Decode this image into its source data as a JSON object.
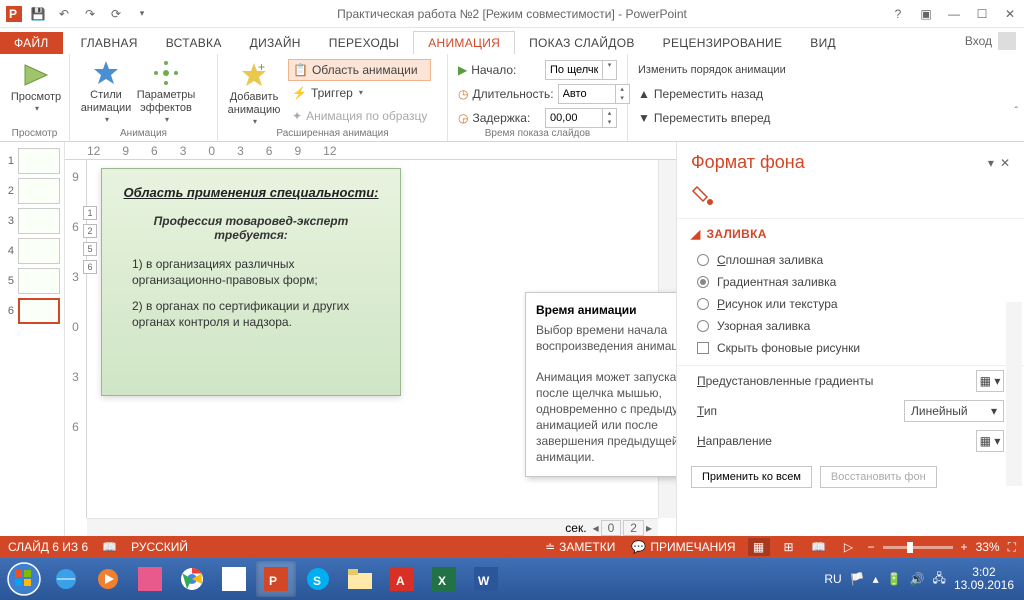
{
  "title": "Практическая работа №2 [Режим совместимости] - PowerPoint",
  "tabs": {
    "file": "ФАЙЛ",
    "home": "ГЛАВНАЯ",
    "insert": "ВСТАВКА",
    "design": "ДИЗАЙН",
    "trans": "ПЕРЕХОДЫ",
    "anim": "АНИМАЦИЯ",
    "show": "ПОКАЗ СЛАЙДОВ",
    "review": "РЕЦЕНЗИРОВАНИЕ",
    "view": "ВИД"
  },
  "signin": "Вход",
  "ribbon": {
    "preview": "Просмотр",
    "preview_grp": "Просмотр",
    "styles": "Стили\nанимации",
    "effects": "Параметры\nэффектов",
    "anim_grp": "Анимация",
    "add": "Добавить\nанимацию",
    "pane": "Область анимации",
    "trigger": "Триггер",
    "painter": "Анимация по образцу",
    "adv_grp": "Расширенная анимация",
    "start": "Начало:",
    "start_val": "По щелчку",
    "dur": "Длительность:",
    "dur_val": "Авто",
    "delay": "Задержка:",
    "delay_val": "00,00",
    "timing_grp": "Время показа слайдов",
    "reorder": "Изменить порядок анимации",
    "moveback": "Переместить назад",
    "movefwd": "Переместить вперед"
  },
  "tooltip": {
    "title": "Время анимации",
    "p1": "Выбор времени начала воспроизведения анимации.",
    "p2": "Анимация может запускаться после щелчка мышью, одновременно с предыдущей анимацией или после завершения предыдущей анимации."
  },
  "ruler_h": [
    "12",
    "9",
    "6",
    "3",
    "0",
    "3",
    "6",
    "9",
    "12"
  ],
  "ruler_v": [
    "9",
    "6",
    "3",
    "0",
    "3",
    "6"
  ],
  "slide": {
    "title": "Область применения специальности:",
    "sub": "Профессия товаровед-эксперт требуется:",
    "li1": "1)  в организациях различных организационно-правовых форм;",
    "li2": "2)  в органах по сертификации и других органах контроля и надзора."
  },
  "anim_tags": [
    "1",
    "2",
    "5",
    "6"
  ],
  "canvas": {
    "sec": "сек.",
    "page_from": "0",
    "page_to": "2"
  },
  "pane": {
    "title": "Формат фона",
    "section": "ЗАЛИВКА",
    "r1": "Сплошная заливка",
    "r2": "Градиентная заливка",
    "r3": "Рисунок или текстура",
    "r4": "Узорная заливка",
    "chk": "Скрыть фоновые рисунки",
    "preset": "Предустановленные градиенты",
    "type": "Тип",
    "type_val": "Линейный",
    "dir": "Направление",
    "apply": "Применить ко всем",
    "restore": "Восстановить фон"
  },
  "status": {
    "slide": "СЛАЙД 6 ИЗ 6",
    "lang": "РУССКИЙ",
    "notes": "ЗАМЕТКИ",
    "comments": "ПРИМЕЧАНИЯ",
    "zoom": "33%"
  },
  "tray": {
    "lang": "RU",
    "time": "3:02",
    "date": "13.09.2016"
  }
}
